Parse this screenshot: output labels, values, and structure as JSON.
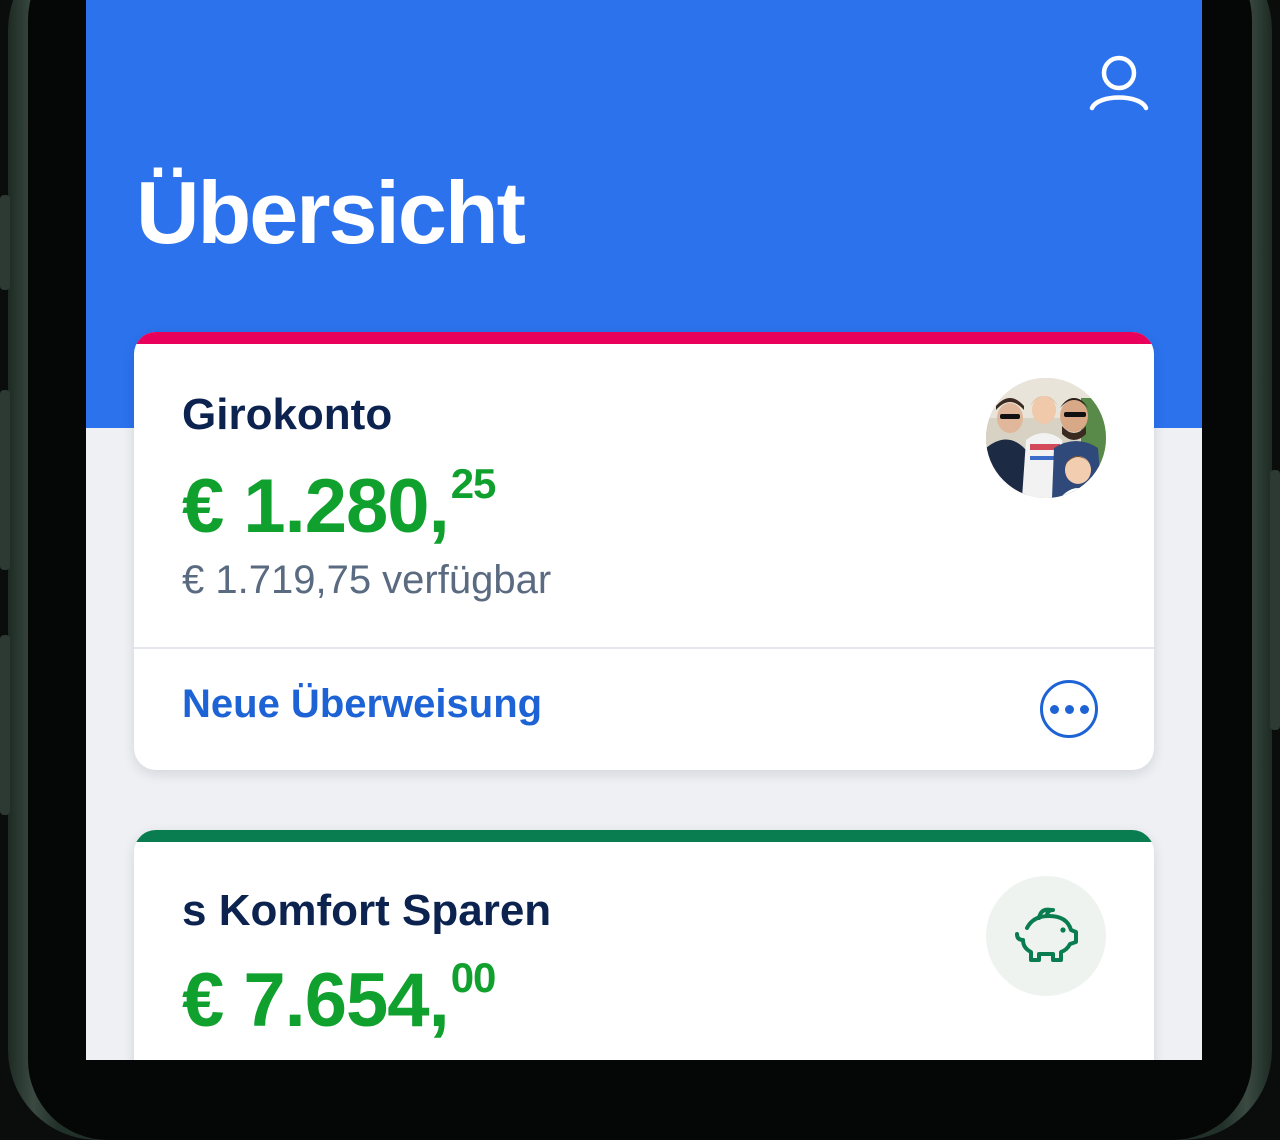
{
  "header": {
    "title": "Übersicht",
    "background_color": "#2b72ec",
    "profile_icon": "user-profile-icon"
  },
  "accounts": [
    {
      "name": "Girokonto",
      "accent_color": "#e8005a",
      "balance_main": "€ 1.280,",
      "balance_cents": "25",
      "available": "€ 1.719,75 verfügbar",
      "action_label": "Neue Überweisung",
      "more_icon": "more-horizontal-icon",
      "image": "family-photo-avatar"
    },
    {
      "name": "s Komfort Sparen",
      "accent_color": "#0a7d50",
      "balance_main": "€ 7.654,",
      "balance_cents": "00",
      "icon": "piggy-bank-icon"
    }
  ],
  "colors": {
    "amount_green": "#10a02e",
    "title_navy": "#0c2350",
    "link_blue": "#1e63d6",
    "screen_bg": "#eef0f3"
  }
}
